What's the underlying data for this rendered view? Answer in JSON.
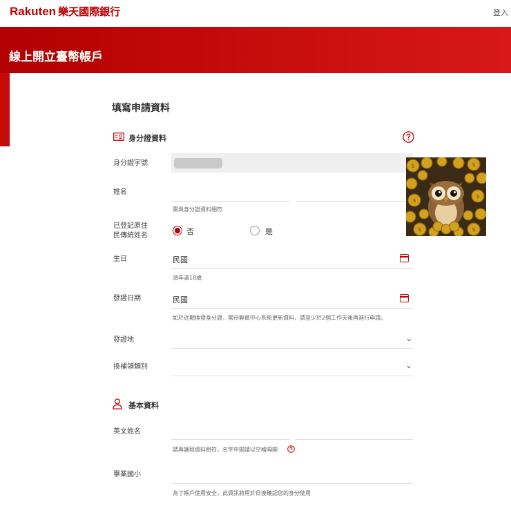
{
  "header": {
    "brand": "Rakuten",
    "bank_name": "樂天國際銀行",
    "login_label": "登入"
  },
  "banner": {
    "title": "線上開立臺幣帳戶"
  },
  "form": {
    "title": "填寫申請資料",
    "id_section": {
      "title": "身分證資料"
    },
    "id_number": {
      "label": "身分證字號"
    },
    "name": {
      "label": "姓名",
      "hint": "需與身分證資料相符"
    },
    "indigenous": {
      "label_line1": "已登記原住",
      "label_line2": "民傳統姓名",
      "option_no": "否",
      "option_yes": "是",
      "selected": "否"
    },
    "birthday": {
      "label": "生日",
      "era": "民國",
      "hint": "須年滿18歲"
    },
    "issue_date": {
      "label": "發證日期",
      "era": "民國",
      "hint": "如於近期換發身分證，需待聯徵中心系統更新資料，請至少於2個工作天後再進行申請。"
    },
    "issue_place": {
      "label": "發證地"
    },
    "renewal_type": {
      "label": "換補領類別"
    },
    "basic_section": {
      "title": "基本資料"
    },
    "english_name": {
      "label": "英文姓名",
      "hint": "請與護照資料相符，名字中間請以空格隔開"
    },
    "elementary_school": {
      "label": "畢業國小",
      "hint": "為了帳戶使用安全，此資訊將用於日後確認您的身分使用"
    }
  },
  "colors": {
    "accent": "#bf0000",
    "banner": "#c80d0d"
  },
  "icons": [
    "help-icon",
    "id-card-icon",
    "calendar-icon",
    "chevron-down-icon",
    "user-icon",
    "info-icon"
  ]
}
